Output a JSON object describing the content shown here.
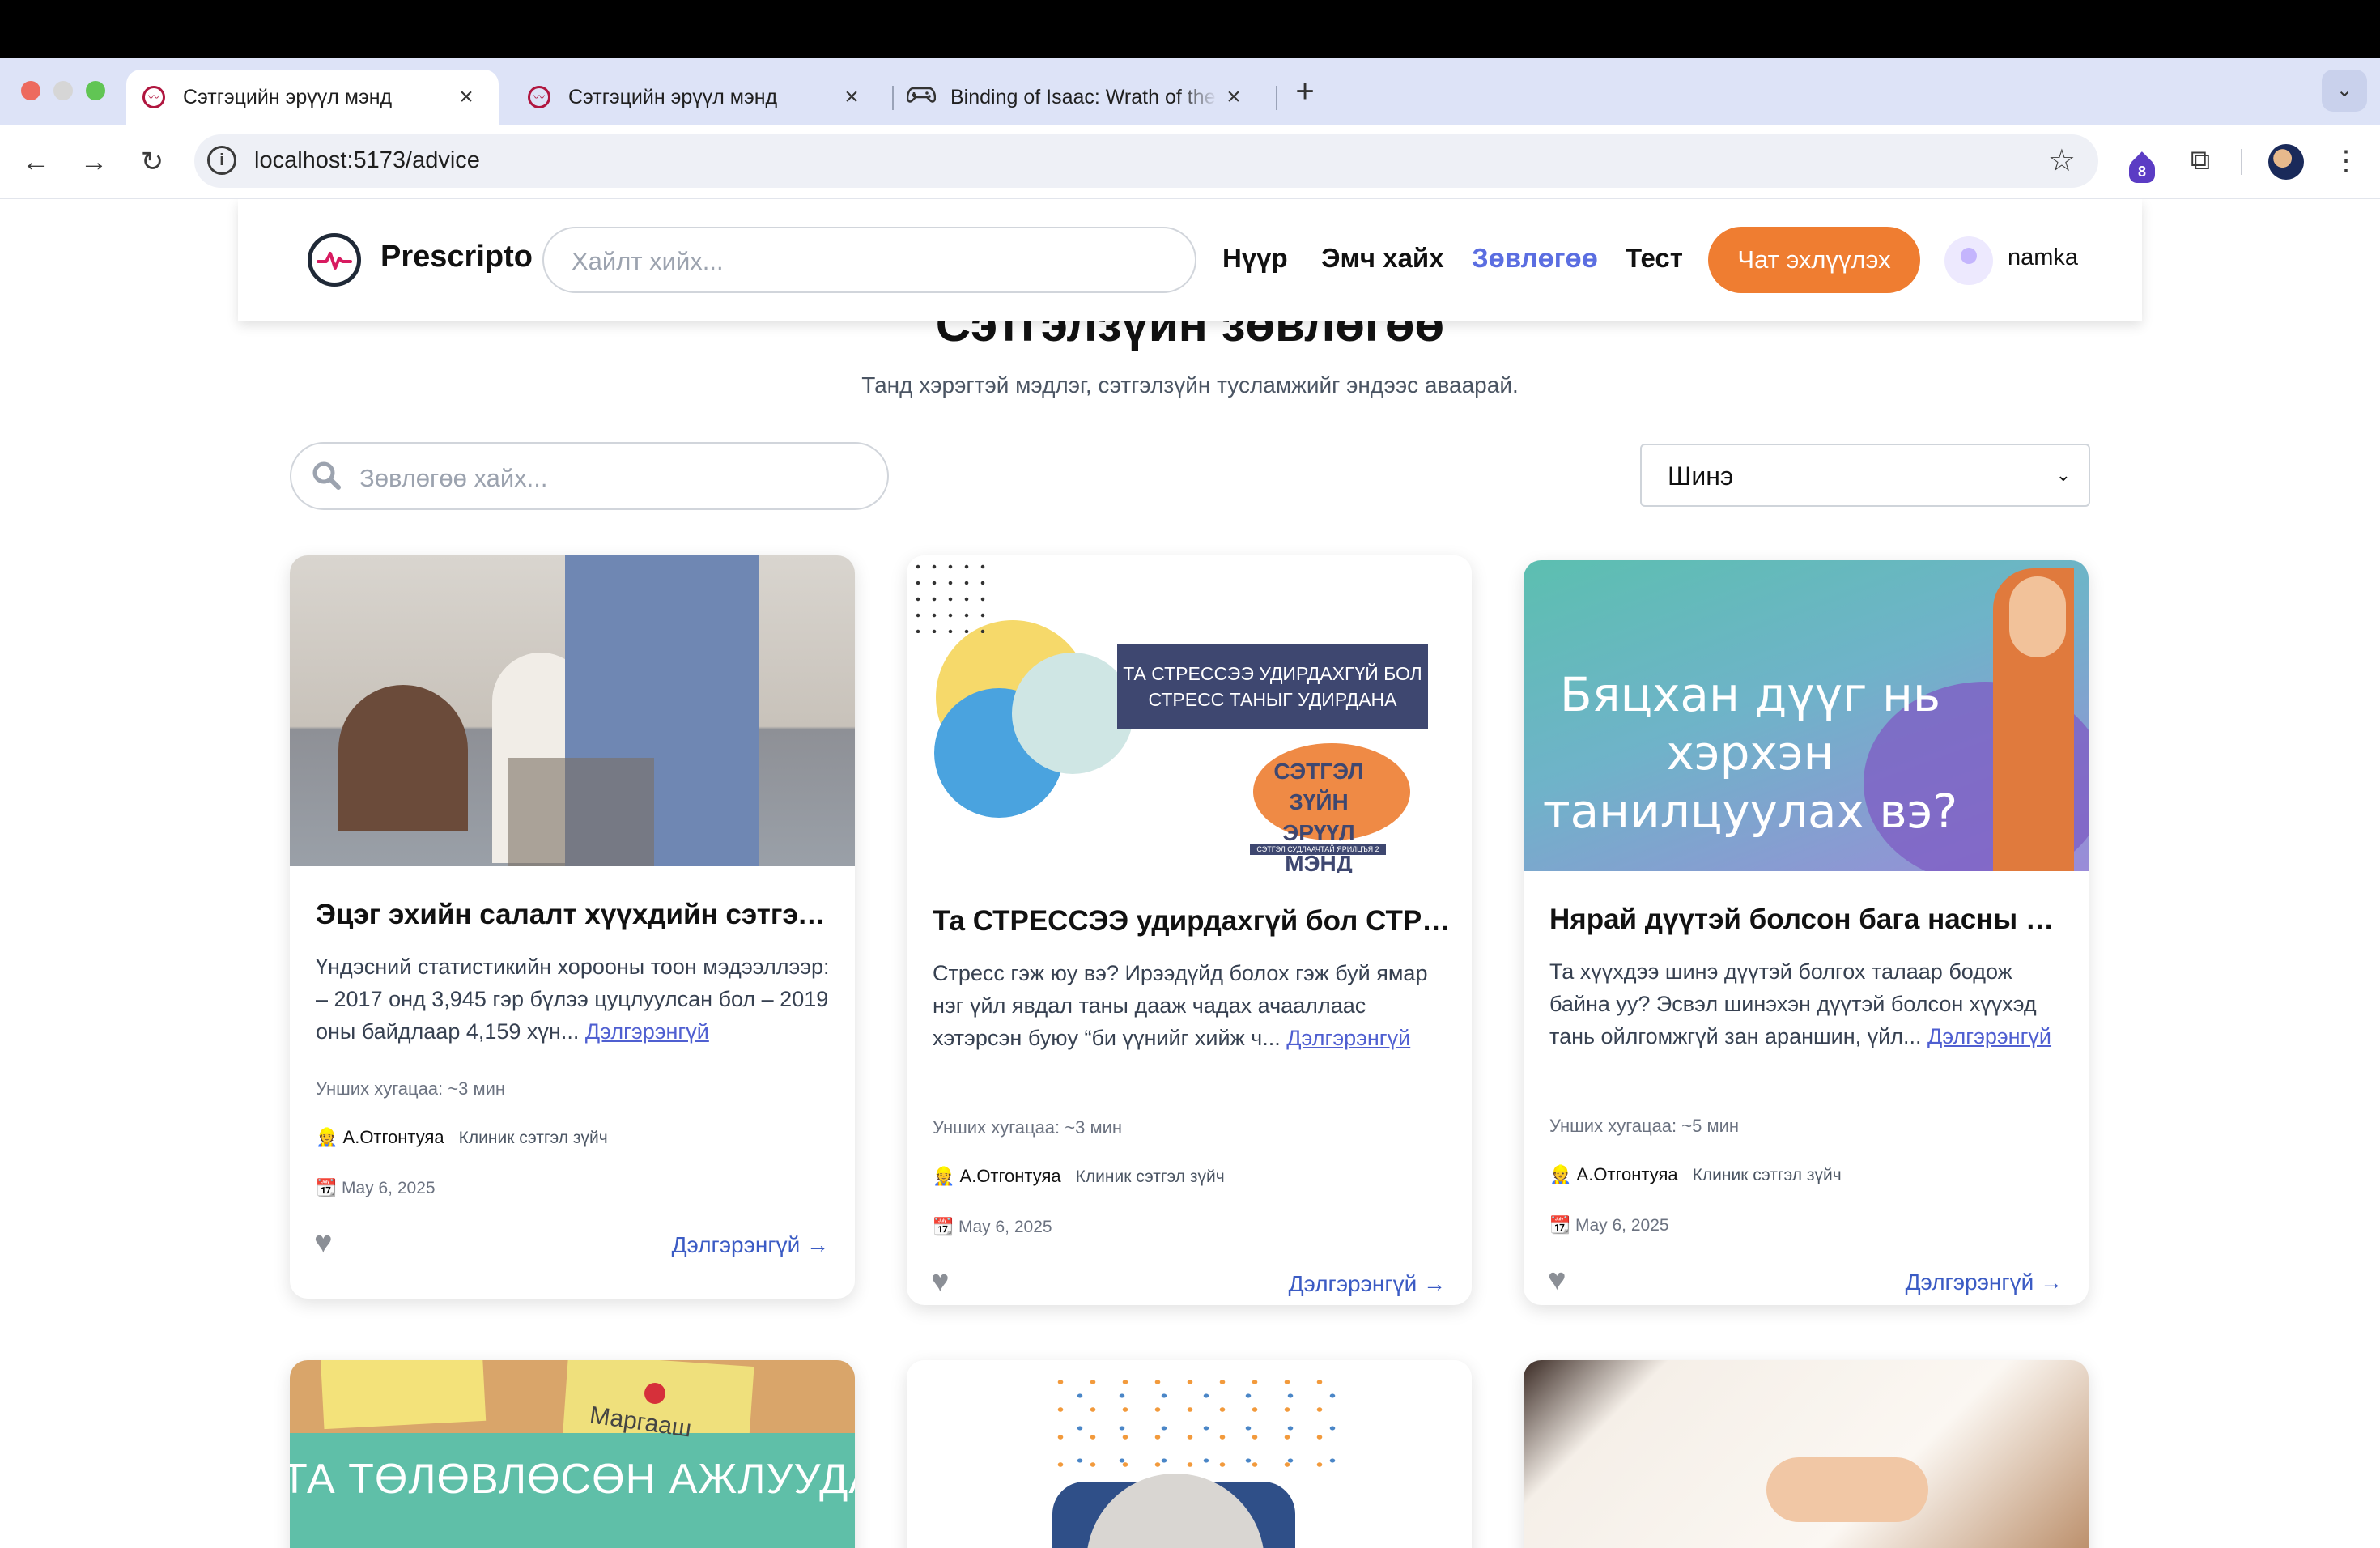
{
  "browser": {
    "tabs": [
      {
        "title": "Сэтгэцийн эрүүл мэнд",
        "active": true,
        "icon": "prescripto-favicon"
      },
      {
        "title": "Сэтгэцийн эрүүл мэнд",
        "active": false,
        "icon": "prescripto-favicon"
      },
      {
        "title": "Binding of Isaac: Wrath of the",
        "active": false,
        "icon": "gamepad-icon"
      }
    ],
    "url": "localhost:5173/advice",
    "extension_badge": "8"
  },
  "navbar": {
    "brand": "Prescripto",
    "search_placeholder": "Хайлт хийх...",
    "links": [
      "Нүүр",
      "Эмч хайх",
      "Зөвлөгөө",
      "Тест"
    ],
    "active_link": "Зөвлөгөө",
    "chat_button": "Чат эхлүүлэх",
    "username": "namka"
  },
  "page": {
    "title": "Сэтгэлзүйн зөвлөгөө",
    "subtitle": "Танд хэрэгтэй мэдлэг, сэтгэлзүйн тусламжийг эндээс аваарай.",
    "search_placeholder": "Зөвлөгөө хайх...",
    "sort_value": "Шинэ"
  },
  "cards": [
    {
      "title": "Эцэг эхийн салалт хүүхдийн сэтгэл ...",
      "excerpt": "Үндэсний статистикийн хорооны тоон мэдээллээр: – 2017 онд 3,945 гэр бүлээ цуцлуулсан бол – 2019 оны байдлаар 4,159 хүн...",
      "more_link": "Дэлгэрэнгүй",
      "read_time": "Унших хугацаа: ~3 мин",
      "author": "А.Отгонтуяа",
      "role": "Клиник сэтгэл зүйч",
      "date": "May 6, 2025",
      "cta": "Дэлгэрэнгүй →"
    },
    {
      "title": "Та СТРЕССЭЭ удирдахгүй бол СТРЕ...",
      "excerpt": "Стресс гэж юу вэ? Ирээдүйд болох гэж буй ямар нэг үйл явдал таны дааж чадах ачааллаас хэтэрсэн буюу “би үүнийг хийж ч...",
      "more_link": "Дэлгэрэнгүй",
      "read_time": "Унших хугацаа: ~3 мин",
      "author": "А.Отгонтуяа",
      "role": "Клиник сэтгэл зүйч",
      "date": "May 6, 2025",
      "cta": "Дэлгэрэнгүй →",
      "image_text": {
        "banner": "ТА СТРЕССЭЭ УДИРДАХГҮЙ БОЛ СТРЕСС ТАНЫГ УДИРДАНА",
        "logo": "СЭТГЭЛ ЗҮЙН ЭРҮҮЛ МЭНД",
        "logo_sub": "СЭТГЭЛ СУДЛААЧТАЙ ЯРИЛЦЪЯ 2 ТӨСӨЛ"
      }
    },
    {
      "title": "Нярай дүүтэй болсон бага насны хү...",
      "excerpt": "Та хүүхдээ шинэ дүүтэй болгох талаар бодож байна уу? Эсвэл шинэхэн дүүтэй болсон хүүхэд тань ойлгомжгүй зан араншин, үйл...",
      "more_link": "Дэлгэрэнгүй",
      "read_time": "Унших хугацаа: ~5 мин",
      "author": "А.Отгонтуяа",
      "role": "Клиник сэтгэл зүйч",
      "date": "May 6, 2025",
      "cta": "Дэлгэрэнгүй →",
      "image_text": {
        "headline": "Бяцхан дүүг нь хэрхэн танилцуулах вэ?"
      }
    }
  ],
  "second_row_images": {
    "card4_text": "ТА ТӨЛӨВЛӨСӨН АЖЛУУДАА ХОЙШЛУУЛСААР БАЙНА УУ?",
    "card4_note": "Маргааш"
  }
}
